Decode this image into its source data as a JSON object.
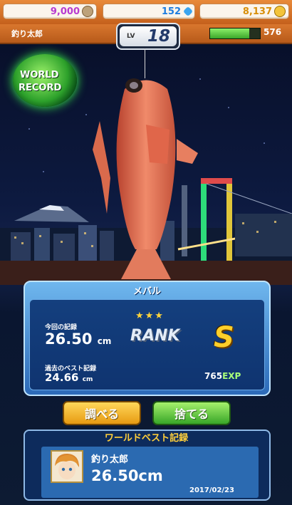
{
  "resources": {
    "coins": "9,000",
    "gems": "152",
    "gold": "8,137"
  },
  "player": {
    "name": "釣り太郎",
    "level_label": "LV",
    "level": "18",
    "exp": "576",
    "exp_fill_fraction": 0.78
  },
  "badge": {
    "line1": "WORLD",
    "line2": "RECORD"
  },
  "catch": {
    "fish_name": "メバル",
    "stars": "★★★",
    "current_label": "今回の記録",
    "current_value": "26.50",
    "current_unit": "cm",
    "best_label": "過去のベスト記録",
    "best_value": "24.66",
    "best_unit": "cm",
    "rank_label": "RANK",
    "rank": "S",
    "exp_gain": "765",
    "exp_unit": "EXP"
  },
  "buttons": {
    "inspect": "調べる",
    "release": "捨てる"
  },
  "world_best": {
    "title": "ワールドベスト記録",
    "holder": "釣り太郎",
    "size": "26.50cm",
    "date": "2017/02/23"
  },
  "colors": {
    "topbar": "#e98a3a",
    "panel": "#2c6ab8",
    "grade": "#ffcf2a",
    "inspect_button": "#e79a12",
    "release_button": "#38a628"
  }
}
